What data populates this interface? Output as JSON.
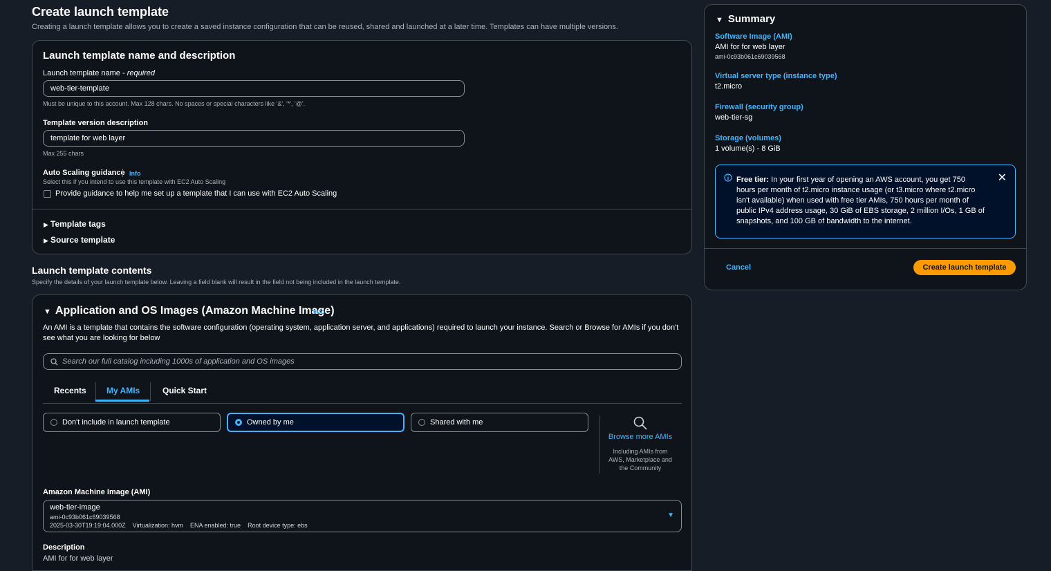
{
  "page": {
    "title": "Create launch template",
    "subtitle": "Creating a launch template allows you to create a saved instance configuration that can be reused, shared and launched at a later time. Templates can have multiple versions."
  },
  "name_section": {
    "heading": "Launch template name and description",
    "name_label": "Launch template name - ",
    "name_label_required": "required",
    "name_value": "web-tier-template",
    "name_hint": "Must be unique to this account. Max 128 chars. No spaces or special characters like '&', '*', '@'.",
    "desc_label": "Template version description",
    "desc_value": "template for web layer",
    "desc_hint": "Max 255 chars",
    "asg_label": "Auto Scaling guidance",
    "asg_info": "Info",
    "asg_hint": "Select this if you intend to use this template with EC2 Auto Scaling",
    "asg_checkbox_label": "Provide guidance to help me set up a template that I can use with EC2 Auto Scaling",
    "template_tags": "Template tags",
    "source_template": "Source template"
  },
  "contents": {
    "heading": "Launch template contents",
    "subtitle": "Specify the details of your launch template below. Leaving a field blank will result in the field not being included in the launch template."
  },
  "ami_section": {
    "heading": "Application and OS Images (Amazon Machine Image)",
    "info": "Info",
    "description": "An AMI is a template that contains the software configuration (operating system, application server, and applications) required to launch your instance. Search or Browse for AMIs if you don't see what you are looking for below",
    "search_placeholder": "Search our full catalog including 1000s of application and OS images",
    "tabs": [
      "Recents",
      "My AMIs",
      "Quick Start"
    ],
    "options": [
      "Don't include in launch template",
      "Owned by me",
      "Shared with me"
    ],
    "browse_label": "Browse more AMIs",
    "browse_desc": "Including AMIs from AWS, Marketplace and the Community",
    "ami_label": "Amazon Machine Image (AMI)",
    "ami_name": "web-tier-image",
    "ami_id": "ami-0c93b061c69039568",
    "ami_date": "2025-03-30T19:19:04.000Z",
    "ami_virt": "Virtualization: hvm",
    "ami_ena": "ENA enabled: true",
    "ami_root": "Root device type: ebs",
    "desc_label": "Description",
    "desc_value_partial": "AMI for for web layer"
  },
  "summary": {
    "heading": "Summary",
    "items": [
      {
        "key": "Software Image (AMI)",
        "value": "AMI for for web layer",
        "extra": "ami-0c93b061c69039568"
      },
      {
        "key": "Virtual server type (instance type)",
        "value": "t2.micro"
      },
      {
        "key": "Firewall (security group)",
        "value": "web-tier-sg"
      },
      {
        "key": "Storage (volumes)",
        "value": "1 volume(s) - 8 GiB"
      }
    ],
    "free_tier_title": "Free tier:",
    "free_tier_text": " In your first year of opening an AWS account, you get 750 hours per month of t2.micro instance usage (or t3.micro where t2.micro isn't available) when used with free tier AMIs, 750 hours per month of public IPv4 address usage, 30 GiB of EBS storage, 2 million I/Os, 1 GB of snapshots, and 100 GB of bandwidth to the internet.",
    "cancel": "Cancel",
    "create": "Create launch template"
  },
  "colors": {
    "background": "#161d26",
    "card": "#0f141a",
    "accent": "#42b4ff",
    "primary": "#ff9900"
  }
}
